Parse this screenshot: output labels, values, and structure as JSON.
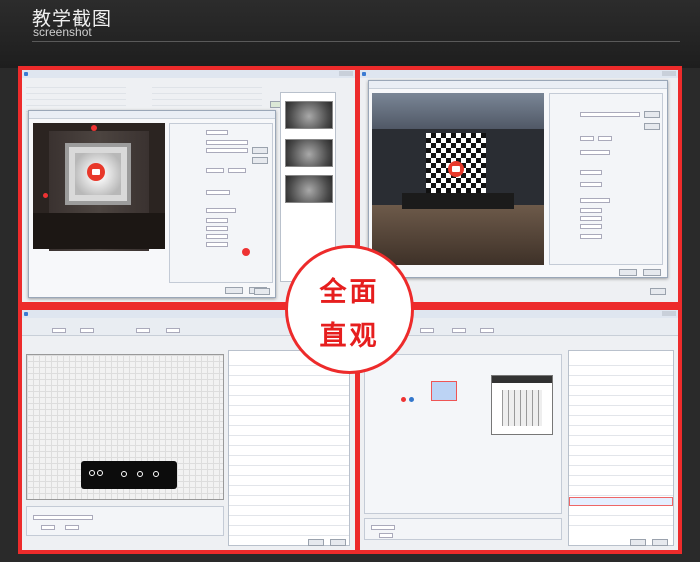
{
  "header": {
    "title": "教学截图",
    "subtitle": "screenshot"
  },
  "badge": {
    "line1": "全面",
    "line2": "直观"
  },
  "colors": {
    "frame": "#ed2b2b",
    "badge_text": "#e61e1e",
    "background": "#2a2a2a"
  },
  "icons": {
    "camera": "camera-icon",
    "location_pin": "location-pin-icon"
  }
}
